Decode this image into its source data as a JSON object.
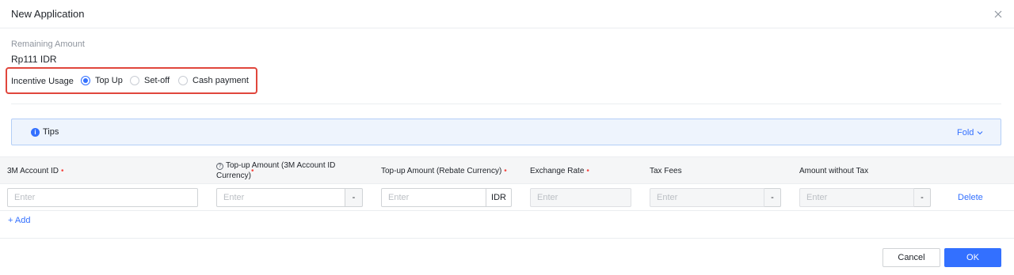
{
  "dialog": {
    "title": "New Application",
    "close_icon": "close-icon"
  },
  "remaining": {
    "label": "Remaining Amount",
    "value": "Rp111 IDR"
  },
  "incentive_usage": {
    "label": "Incentive Usage",
    "options": [
      {
        "label": "Top Up",
        "checked": true
      },
      {
        "label": "Set-off",
        "checked": false
      },
      {
        "label": "Cash payment",
        "checked": false
      }
    ]
  },
  "tips": {
    "label": "Tips",
    "icon": "info-icon",
    "fold_label": "Fold"
  },
  "table": {
    "columns": {
      "account_id": "3M Account ID",
      "topup_3m_line1": "Top-up Amount (3M Account ID",
      "topup_3m_line2": "Currency)",
      "topup_rebate": "Top-up Amount (Rebate Currency)",
      "exchange_rate": "Exchange Rate",
      "tax_fees": "Tax Fees",
      "amount_without_tax": "Amount without Tax"
    },
    "row": {
      "placeholder": "Enter",
      "topup_3m_addon": "-",
      "rebate_addon": "IDR",
      "tax_addon": "-",
      "amount_addon": "-",
      "delete_label": "Delete"
    },
    "add_label": "+ Add"
  },
  "footer": {
    "cancel_label": "Cancel",
    "ok_label": "OK"
  },
  "colors": {
    "primary": "#3370ff",
    "required": "#f54a45",
    "highlight_border": "#e0463c"
  }
}
